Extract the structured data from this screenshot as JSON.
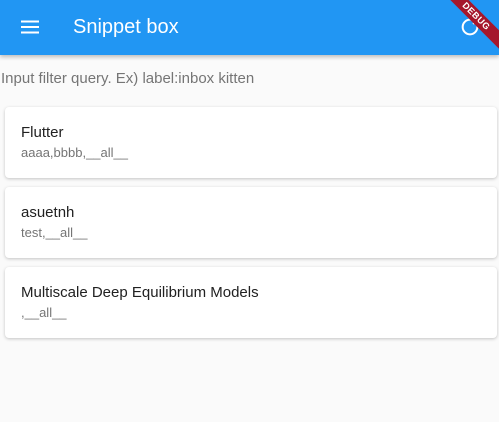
{
  "colors": {
    "app_bar": "#2196f3",
    "debug_banner": "#a5172c",
    "background": "#fafafa",
    "card": "#ffffff"
  },
  "app_bar": {
    "title": "Snippet box",
    "menu_icon": "hamburger-menu-icon",
    "action_icon": "sync-icon"
  },
  "debug_banner": {
    "label": "DEBUG"
  },
  "filter": {
    "placeholder": "Input filter query. Ex) label:inbox kitten",
    "value": ""
  },
  "snippets": [
    {
      "title": "Flutter",
      "labels": "aaaa,bbbb,__all__"
    },
    {
      "title": "asuetnh",
      "labels": "test,__all__"
    },
    {
      "title": "Multiscale Deep Equilibrium Models",
      "labels": ",__all__"
    }
  ]
}
